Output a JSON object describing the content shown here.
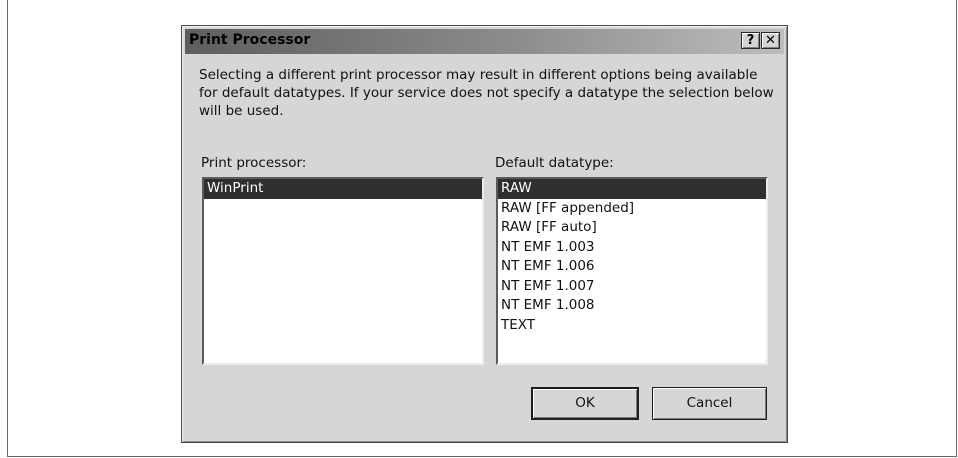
{
  "dialog": {
    "title": "Print Processor",
    "help_glyph": "?",
    "close_glyph": "✕",
    "description": "Selecting a different print processor may result in different options being available for default datatypes. If your service does not specify a datatype the selection below will be used.",
    "print_processor_label": "Print processor:",
    "default_datatype_label": "Default datatype:",
    "print_processors": [
      {
        "label": "WinPrint",
        "selected": true
      }
    ],
    "datatypes": [
      {
        "label": "RAW",
        "selected": true
      },
      {
        "label": "RAW [FF appended]",
        "selected": false
      },
      {
        "label": "RAW [FF auto]",
        "selected": false
      },
      {
        "label": "NT EMF 1.003",
        "selected": false
      },
      {
        "label": "NT EMF 1.006",
        "selected": false
      },
      {
        "label": "NT EMF 1.007",
        "selected": false
      },
      {
        "label": "NT EMF 1.008",
        "selected": false
      },
      {
        "label": "TEXT",
        "selected": false
      }
    ],
    "ok_label": "OK",
    "cancel_label": "Cancel"
  },
  "icons": {
    "help": "question-mark-icon",
    "close": "close-icon"
  },
  "colors": {
    "dialog_bg": "#d6d6d6",
    "selection_bg": "#2f2f2f",
    "selection_fg": "#ffffff"
  }
}
